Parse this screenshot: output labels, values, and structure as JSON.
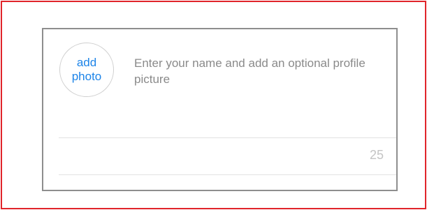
{
  "profile_setup": {
    "avatar_button": {
      "line1": "add",
      "line2": "photo"
    },
    "hint_text": "Enter your name and add an optional profile picture",
    "name_field": {
      "value": "",
      "char_counter": "25"
    }
  },
  "colors": {
    "outer_border": "#e0242a",
    "card_border": "#8e8e8e",
    "accent_link": "#1d84e8",
    "hint_text": "#8a8a8a",
    "counter_text": "#c4c4c4"
  }
}
